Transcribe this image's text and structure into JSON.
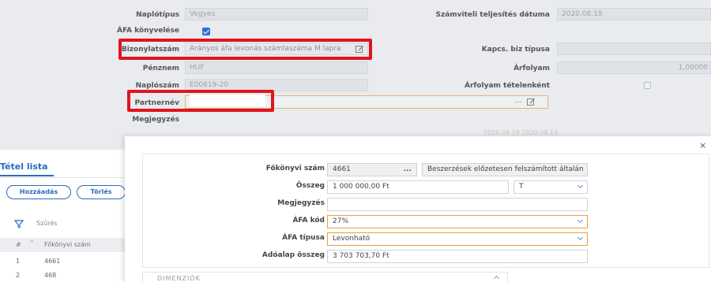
{
  "form": {
    "naplotipus_label": "Naplótípus",
    "naplotipus_value": "Vegyes",
    "afa_konyvelese_label": "ÁFA könyvelése",
    "bizonylatszam_label": "Bizonylatszám",
    "bizonylatszam_value": "Arányos áfa levonás számlaszáma M lapra",
    "penznem_label": "Pénznem",
    "penznem_value": "HUF",
    "naploszam_label": "Naplószám",
    "naploszam_value": "E00619-20",
    "partnernev_label": "Partnernév",
    "partnernev_value": "",
    "partnernev_dots": "...",
    "megjegyzes_label": "Megjegyzés",
    "szamviteli_label": "Számviteli teljesítés dátuma",
    "szamviteli_value": "2020.08.19.",
    "kapcs_label": "Kapcs. biz típusa",
    "arfolyam_label": "Árfolyam",
    "arfolyam_value": "1,00000",
    "arfolyam_tetel_label": "Árfolyam tételenként",
    "faded_row": "2020.08.19     2020.08.19"
  },
  "list": {
    "title": "Tétel lista",
    "add_button": "Hozzáadás",
    "delete_button": "Törlés",
    "filter_label": "Szűrés",
    "columns": {
      "hash": "#",
      "fokonyvi": "Főkönyvi szám"
    },
    "rows": [
      {
        "num": "1",
        "fokonyvi": "4661"
      },
      {
        "num": "2",
        "fokonyvi": "468"
      }
    ]
  },
  "modal": {
    "close_glyph": "×",
    "fokonyvi_label": "Főkönyvi szám",
    "fokonyvi_value": "4661",
    "fokonyvi_dots": "...",
    "fokonyvi_desc": "Beszerzések előzetesen felszámított általán",
    "osszeg_label": "Összeg",
    "osszeg_value": "1 000 000,00 Ft",
    "tk_value": "T",
    "megjegyzes_label": "Megjegyzés",
    "megjegyzes_value": "",
    "afa_kod_label": "ÁFA kód",
    "afa_kod_value": "27%",
    "afa_tipusa_label": "ÁFA típusa",
    "afa_tipusa_value": "Levonható",
    "adoalap_label": "Adóalap összeg",
    "adoalap_value": "3 703 703,70 Ft",
    "dimenziok_label": "DIMENZIÓK"
  },
  "colors": {
    "highlight": "#e0141e",
    "accent": "#2a6bbf",
    "focus": "#e8a13c"
  }
}
